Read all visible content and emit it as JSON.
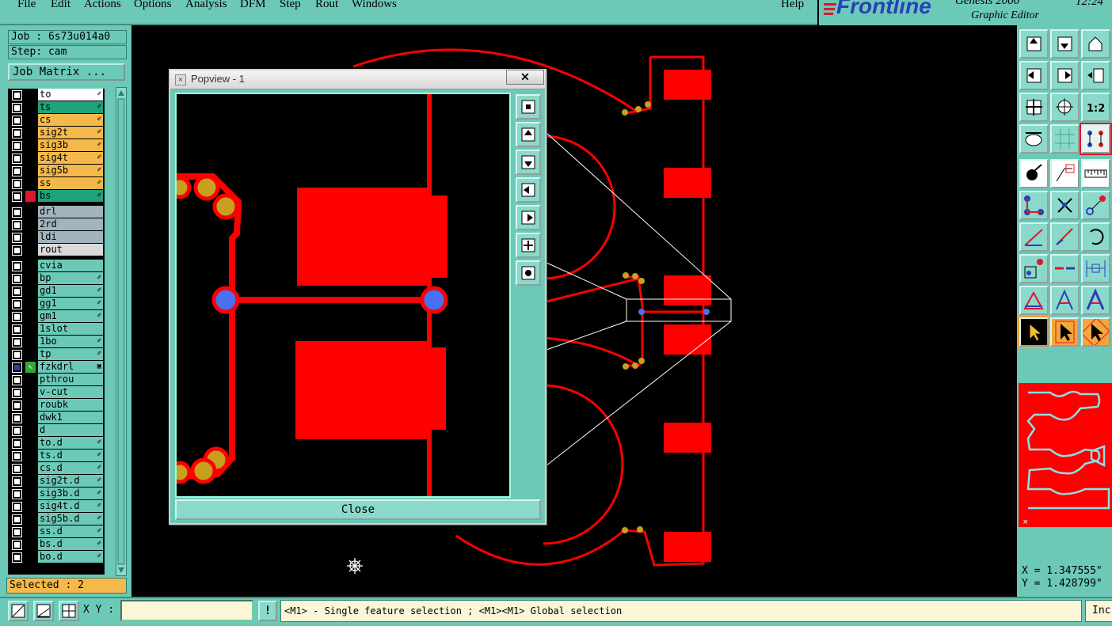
{
  "menubar": {
    "items": [
      "File",
      "Edit",
      "Actions",
      "Options",
      "Analysis",
      "DFM",
      "Step",
      "Rout",
      "Windows"
    ],
    "help": "Help"
  },
  "logo": {
    "brand": "Frontline",
    "product": "Genesis 2000",
    "subtitle": "Graphic Editor",
    "time": "12:24"
  },
  "job": {
    "job_label": "Job : 6s73u014a0",
    "step_label": "Step: cam",
    "matrix_button": "Job Matrix ..."
  },
  "layers": [
    {
      "name": "to",
      "color": "#ffffff",
      "flag": "✐"
    },
    {
      "name": "ts",
      "color": "#1ea37a",
      "flag": "✐"
    },
    {
      "name": "cs",
      "color": "#f5b84a",
      "flag": "✐"
    },
    {
      "name": "sig2t",
      "color": "#f5b84a",
      "flag": "✐"
    },
    {
      "name": "sig3b",
      "color": "#f5b84a",
      "flag": "✐"
    },
    {
      "name": "sig4t",
      "color": "#f5b84a",
      "flag": "✐"
    },
    {
      "name": "sig5b",
      "color": "#f5b84a",
      "flag": "✐"
    },
    {
      "name": "ss",
      "color": "#f5b84a",
      "flag": "✐"
    },
    {
      "name": "bs",
      "color": "#1ea37a",
      "flag": "✐",
      "active": true
    },
    {
      "name": "drl",
      "color": "#9fb4bc",
      "flag": ""
    },
    {
      "name": "2rd",
      "color": "#9fb4bc",
      "flag": ""
    },
    {
      "name": "ldi",
      "color": "#9fb4bc",
      "flag": ""
    },
    {
      "name": "rout",
      "color": "#d9d9d9",
      "flag": ""
    },
    {
      "name": "cvia",
      "color": "#6cc9b8",
      "flag": ""
    },
    {
      "name": "bp",
      "color": "#6cc9b8",
      "flag": "✐"
    },
    {
      "name": "gd1",
      "color": "#6cc9b8",
      "flag": "✐"
    },
    {
      "name": "gg1",
      "color": "#6cc9b8",
      "flag": "✐"
    },
    {
      "name": "gm1",
      "color": "#6cc9b8",
      "flag": "✐"
    },
    {
      "name": "1slot",
      "color": "#6cc9b8",
      "flag": ""
    },
    {
      "name": "1bo",
      "color": "#6cc9b8",
      "flag": "✐"
    },
    {
      "name": "tp",
      "color": "#6cc9b8",
      "flag": "✐"
    },
    {
      "name": "fzkdrl",
      "color": "#6cc9b8",
      "flag": "▣",
      "work": true
    },
    {
      "name": "pthrou",
      "color": "#6cc9b8",
      "flag": ""
    },
    {
      "name": "v-cut",
      "color": "#6cc9b8",
      "flag": ""
    },
    {
      "name": "roubk",
      "color": "#6cc9b8",
      "flag": ""
    },
    {
      "name": "dwk1",
      "color": "#6cc9b8",
      "flag": ""
    },
    {
      "name": "d",
      "color": "#6cc9b8",
      "flag": ""
    },
    {
      "name": "to.d",
      "color": "#6cc9b8",
      "flag": "✐"
    },
    {
      "name": "ts.d",
      "color": "#6cc9b8",
      "flag": "✐"
    },
    {
      "name": "cs.d",
      "color": "#6cc9b8",
      "flag": "✐"
    },
    {
      "name": "sig2t.d",
      "color": "#6cc9b8",
      "flag": "✐"
    },
    {
      "name": "sig3b.d",
      "color": "#6cc9b8",
      "flag": "✐"
    },
    {
      "name": "sig4t.d",
      "color": "#6cc9b8",
      "flag": "✐"
    },
    {
      "name": "sig5b.d",
      "color": "#6cc9b8",
      "flag": "✐"
    },
    {
      "name": "ss.d",
      "color": "#6cc9b8",
      "flag": "✐"
    },
    {
      "name": "bs.d",
      "color": "#6cc9b8",
      "flag": "✐"
    },
    {
      "name": "bo.d",
      "color": "#6cc9b8",
      "flag": "✐"
    }
  ],
  "selected": "Selected : 2",
  "bottom": {
    "xy_label": "X Y :",
    "xy_value": "",
    "status": "<M1> - Single feature selection ; <M1><M1> Global selection",
    "inc": "Inc"
  },
  "coords": {
    "x": "X = 1.347555\"",
    "y": "Y = 1.428799\""
  },
  "popview": {
    "title": "Popview - 1",
    "close_x": "✕",
    "close_button": "Close"
  },
  "colors": {
    "panel": "#6cc9b8",
    "copper": "#ff0000",
    "pad": "#c8a020",
    "via": "#4a6ff0"
  }
}
